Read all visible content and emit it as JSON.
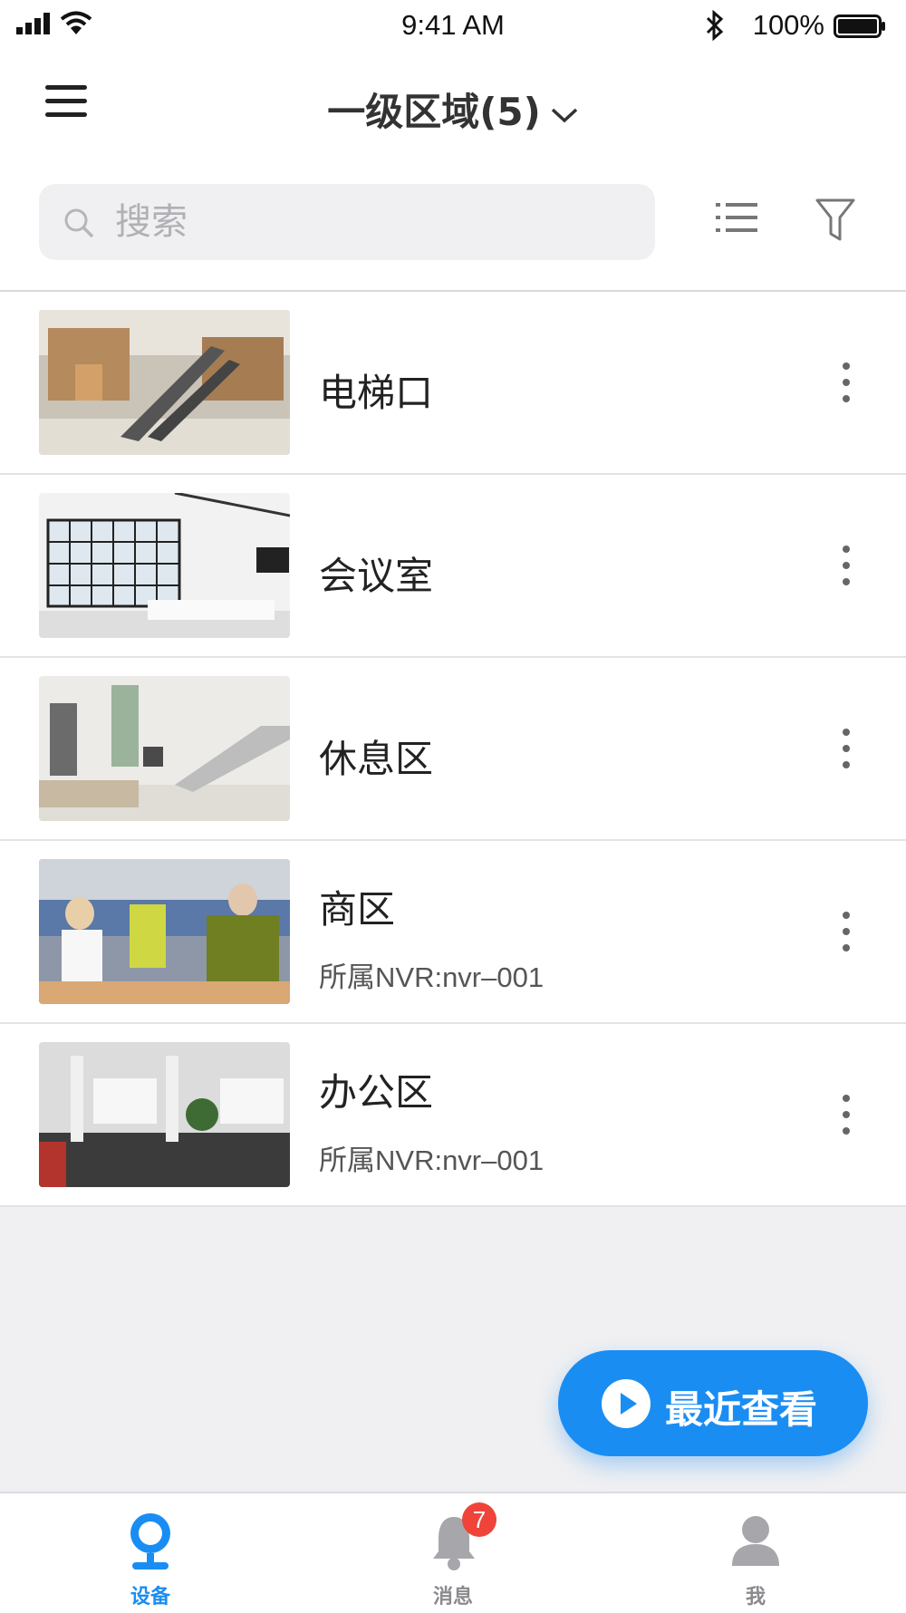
{
  "status_bar": {
    "time": "9:41 AM",
    "battery_percent": "100%"
  },
  "header": {
    "title": "一级区域(5)"
  },
  "search": {
    "placeholder": "搜索"
  },
  "items": [
    {
      "name": "电梯口",
      "sub": ""
    },
    {
      "name": "会议室",
      "sub": ""
    },
    {
      "name": "休息区",
      "sub": ""
    },
    {
      "name": "商区",
      "sub": "所属NVR:nvr–001"
    },
    {
      "name": "办公区",
      "sub": "所属NVR:nvr–001"
    }
  ],
  "fab": {
    "label": "最近查看"
  },
  "tabs": [
    {
      "label": "设备",
      "active": true
    },
    {
      "label": "消息",
      "badge": "7"
    },
    {
      "label": "我"
    }
  ],
  "colors": {
    "accent": "#1a8df3",
    "badge": "#f0433a",
    "inactive": "#a7a7ab"
  }
}
